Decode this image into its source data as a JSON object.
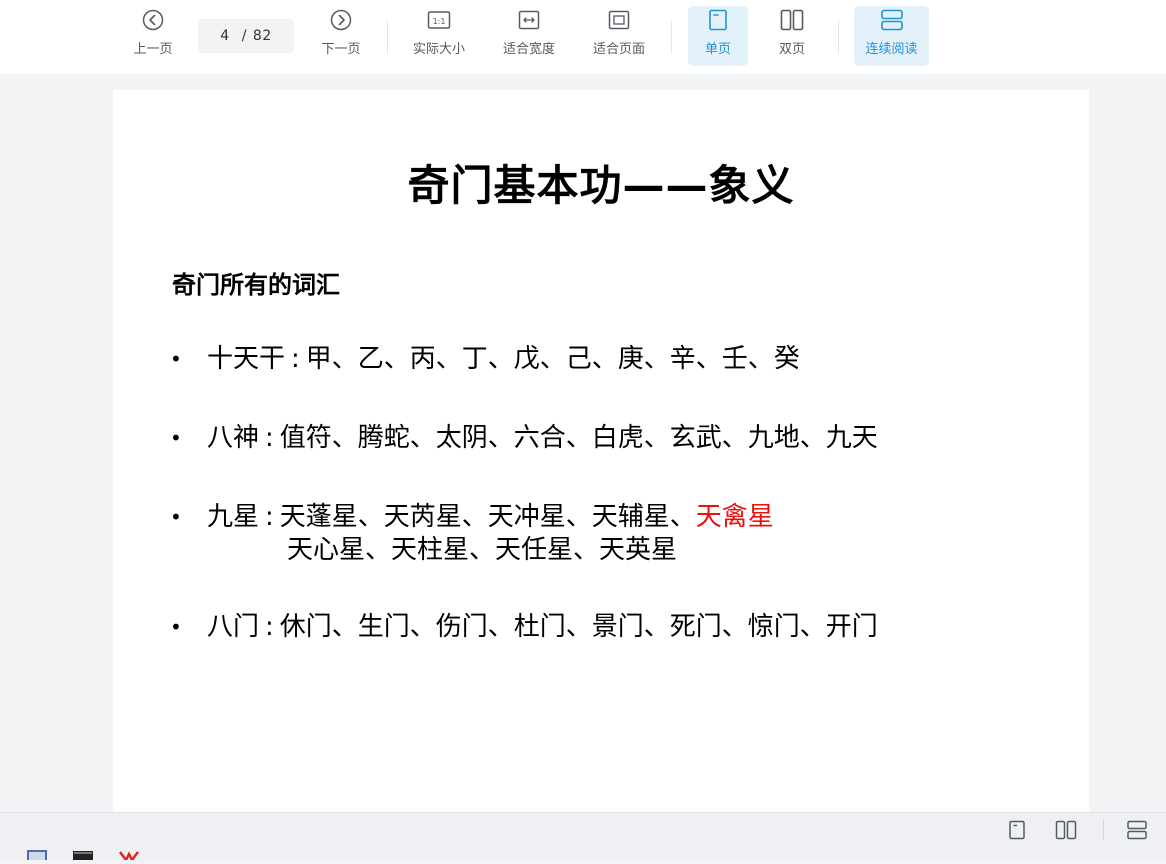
{
  "toolbar": {
    "prev_label": "上一页",
    "next_label": "下一页",
    "current_page": "4",
    "page_separator": "/",
    "total_pages": "82",
    "actual_size_label": "实际大小",
    "fit_width_label": "适合宽度",
    "fit_page_label": "适合页面",
    "single_page_label": "单页",
    "double_page_label": "双页",
    "continuous_label": "连续阅读",
    "active_color": "#1f93d6"
  },
  "document": {
    "title": "奇门基本功——象义",
    "section_heading": "奇门所有的词汇",
    "bullet_symbol": "•",
    "colon": ":",
    "items": [
      {
        "label": "十天干",
        "values": "甲、乙、丙、丁、戊、己、庚、辛、壬、癸"
      },
      {
        "label": "八神",
        "values": "值符、腾蛇、太阴、六合、白虎、玄武、九地、九天"
      },
      {
        "label": "九星",
        "values": "天蓬星、天芮星、天冲星、天辅星、",
        "highlight": "天禽星",
        "values_line2": "天心星、天柱星、天任星、天英星"
      },
      {
        "label": "八门",
        "values": "休门、生门、伤门、杜门、景门、死门、惊门、开门"
      }
    ],
    "highlight_color": "#e8120c"
  },
  "icons": {
    "prev": "chevron-left-circle-icon",
    "next": "chevron-right-circle-icon",
    "actual_size": "one-to-one-icon",
    "fit_width": "fit-width-icon",
    "fit_page": "fit-page-icon",
    "single_page": "single-page-icon",
    "double_page": "double-page-icon",
    "continuous": "continuous-scroll-icon"
  }
}
